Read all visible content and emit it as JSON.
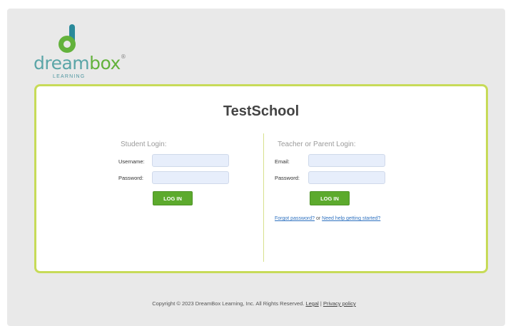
{
  "brand": {
    "name_part1": "dream",
    "name_part2": "box",
    "trademark": "®",
    "sub": "LEARNING"
  },
  "school_name": "TestSchool",
  "student": {
    "title": "Student Login:",
    "username_label": "Username:",
    "password_label": "Password:",
    "username_value": "",
    "password_value": "",
    "button": "LOG IN"
  },
  "teacher": {
    "title": "Teacher or Parent Login:",
    "email_label": "Email:",
    "password_label": "Password:",
    "email_value": "",
    "password_value": "",
    "button": "LOG IN",
    "forgot_link": "Forgot password?",
    "or_text": "or",
    "help_link": "Need help getting started?"
  },
  "footer": {
    "copyright": "Copyright © 2023 DreamBox Learning, Inc. All Rights Reserved.",
    "legal_link": "Legal",
    "separator": "|",
    "privacy_link": "Privacy policy"
  },
  "colors": {
    "accent_green": "#5caa2d",
    "card_border": "#c7db58",
    "link_blue": "#2f72c0"
  }
}
